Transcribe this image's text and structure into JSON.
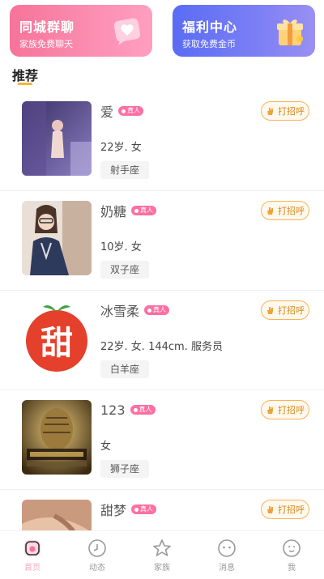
{
  "banners": {
    "left": {
      "title": "同城群聊",
      "subtitle": "家族免费聊天"
    },
    "right": {
      "title": "福利中心",
      "subtitle": "获取免费金币"
    }
  },
  "section": {
    "title": "推荐"
  },
  "cards": [
    {
      "name": "爱",
      "badge": "真人",
      "info": "22岁. 女",
      "zodiac": "射手座",
      "greet": "打招呼"
    },
    {
      "name": "奶糖",
      "badge": "真人",
      "info": "10岁. 女",
      "zodiac": "双子座",
      "greet": "打招呼"
    },
    {
      "name": "冰雪柔",
      "badge": "真人",
      "info": "22岁. 女. 144cm. 服务员",
      "zodiac": "白羊座",
      "greet": "打招呼",
      "avatar_text": "甜"
    },
    {
      "name": "123",
      "badge": "真人",
      "info": "女",
      "zodiac": "狮子座",
      "greet": "打招呼"
    },
    {
      "name": "甜梦",
      "badge": "真人",
      "info": "",
      "zodiac": "",
      "greet": "打招呼"
    }
  ],
  "tabbar": [
    {
      "label": "首页",
      "icon": "home-icon",
      "active": true
    },
    {
      "label": "动态",
      "icon": "moment-icon",
      "active": false
    },
    {
      "label": "家族",
      "icon": "family-star-icon",
      "active": false
    },
    {
      "label": "消息",
      "icon": "message-icon",
      "active": false
    },
    {
      "label": "我",
      "icon": "profile-icon",
      "active": false
    }
  ],
  "colors": {
    "accent_pink": "#f7739a",
    "accent_purple": "#5a6cf5",
    "greet_orange": "#d48a1e",
    "badge_pink": "#ff6fa3"
  }
}
